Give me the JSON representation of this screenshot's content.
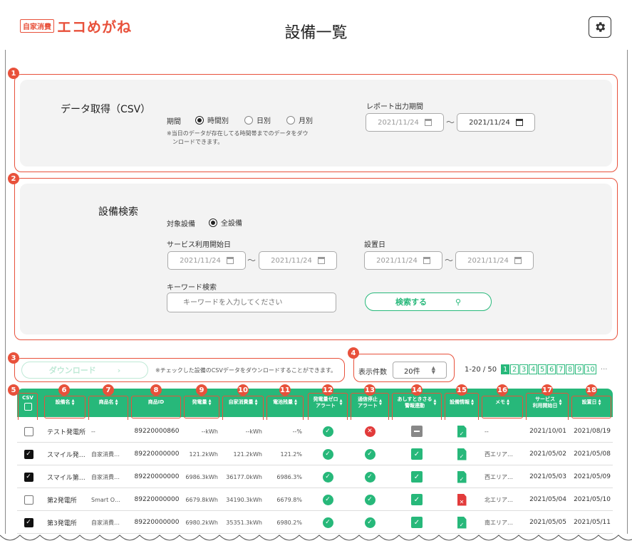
{
  "header": {
    "logo_badge": "自家消費",
    "logo_text": "エコめがね",
    "title": "設備一覧"
  },
  "badges": [
    "1",
    "2",
    "3",
    "4",
    "5",
    "6",
    "7",
    "8",
    "9",
    "10",
    "11",
    "12",
    "13",
    "14",
    "15",
    "16",
    "17",
    "18"
  ],
  "csv_section": {
    "title": "データ取得（CSV）",
    "period_label": "期間",
    "options": [
      "時間別",
      "日別",
      "月別"
    ],
    "selected": "時間別",
    "note_line1": "※当日のデータが存在してる時間帯までのデータをダウ",
    "note_line2": "ンロードできます。",
    "report_label": "レポート出力期間",
    "report_from": "2021/11/24",
    "report_to": "2021/11/24"
  },
  "search_section": {
    "title": "設備検索",
    "target_label": "対象設備",
    "target_option": "全設備",
    "service_label": "サービス利用開始日",
    "service_from": "2021/11/24",
    "service_to": "2021/11/24",
    "install_label": "設置日",
    "install_from": "2021/11/24",
    "install_to": "2021/11/24",
    "keyword_label": "キーワード検索",
    "keyword_placeholder": "キーワードを入力してください",
    "search_button": "検索する"
  },
  "toolbar": {
    "download_button": "ダウンロード",
    "download_note": "※チェックした設備のCSVデータをダウンロードすることができます。",
    "per_page_label": "表示件数",
    "per_page_value": "20件",
    "range": "1-20 / 50",
    "pages": [
      "1",
      "2",
      "3",
      "4",
      "5",
      "6",
      "7",
      "8",
      "9",
      "10"
    ],
    "more": "···"
  },
  "table": {
    "headers": {
      "csv": "CSV",
      "name": "設備名",
      "product": "商品名",
      "product_id": "商品ID",
      "generation": "発電量",
      "consumption": "自家消費量",
      "battery": "電池残量",
      "zero_alert_1": "発電量ゼロ",
      "zero_alert_2": "アラート",
      "comm_alert_1": "通信停止",
      "comm_alert_2": "アラート",
      "ashita_1": "あしすときさる",
      "ashita_2": "警報連動",
      "info": "設備情報",
      "memo": "メモ",
      "service_1": "サービス",
      "service_2": "利用開始日",
      "install": "設置日"
    },
    "rows": [
      {
        "checked": false,
        "name": "テスト発電所",
        "product": "--",
        "product_id": "89220000860",
        "generation": "--kWh",
        "consumption": "--kWh",
        "battery": "--%",
        "zero": "ok",
        "comm": "ng",
        "ashita": "gray",
        "info": "ok",
        "memo": "--",
        "service": "2021/10/01",
        "install": "2021/08/19"
      },
      {
        "checked": true,
        "name": "スマイル発…",
        "product": "自家消費…",
        "product_id": "89220000000",
        "generation": "121.2kWh",
        "consumption": "121.2kWh",
        "battery": "121.2%",
        "zero": "ok",
        "comm": "ok",
        "ashita": "ok",
        "info": "ok",
        "memo": "西エリア…",
        "service": "2021/05/02",
        "install": "2021/05/08"
      },
      {
        "checked": true,
        "name": "スマイル第…",
        "product": "自家消費…",
        "product_id": "89220000000",
        "generation": "6986.3kWh",
        "consumption": "36177.0kWh",
        "battery": "6986.3%",
        "zero": "ok",
        "comm": "ok",
        "ashita": "ok",
        "info": "ok",
        "memo": "西エリア…",
        "service": "2021/05/03",
        "install": "2021/05/09"
      },
      {
        "checked": false,
        "name": "第2発電所",
        "product": "Smart O…",
        "product_id": "89220000000",
        "generation": "6679.8kWh",
        "consumption": "34190.3kWh",
        "battery": "6679.8%",
        "zero": "ok",
        "comm": "ok",
        "ashita": "ok",
        "info": "ng",
        "memo": "北エリア…",
        "service": "2021/05/04",
        "install": "2021/05/10"
      },
      {
        "checked": true,
        "name": "第3発電所",
        "product": "自家消費…",
        "product_id": "89220000000",
        "generation": "6980.2kWh",
        "consumption": "35351.3kWh",
        "battery": "6980.2%",
        "zero": "ok",
        "comm": "ok",
        "ashita": "ok",
        "info": "ok",
        "memo": "南エリア…",
        "service": "2021/05/05",
        "install": "2021/05/11"
      }
    ]
  }
}
